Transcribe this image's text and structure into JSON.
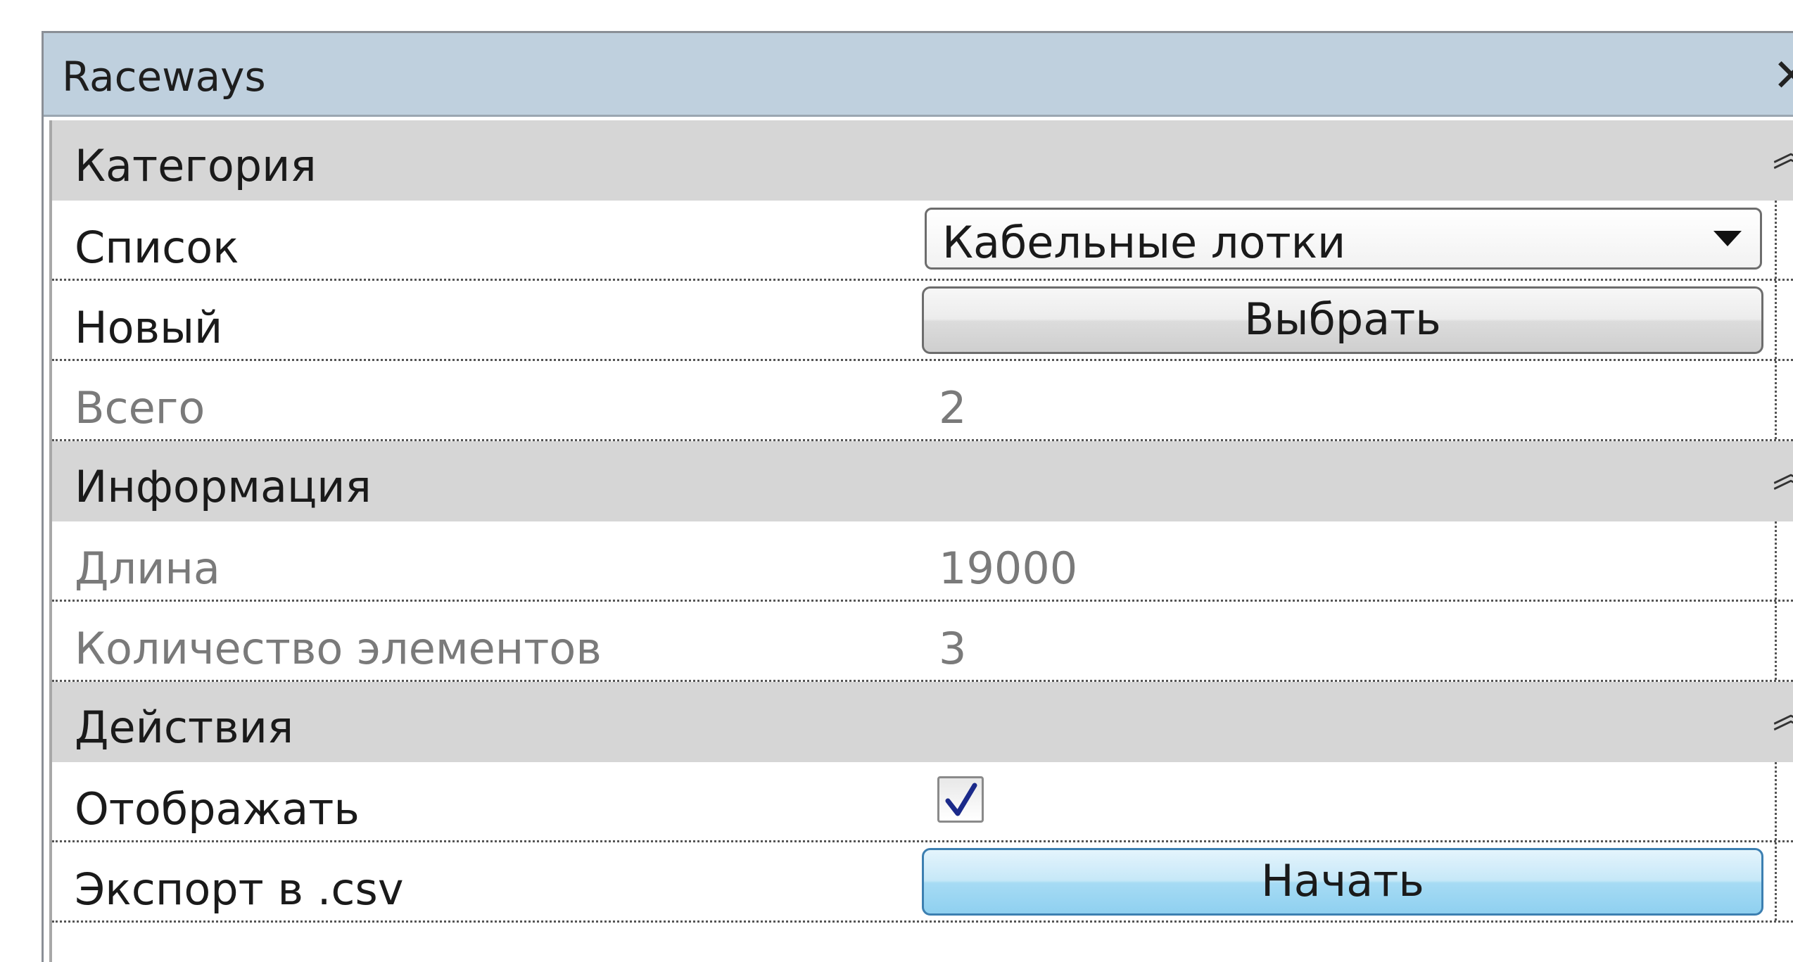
{
  "window": {
    "title": "Raceways",
    "close_glyph": "✕"
  },
  "sections": {
    "category": {
      "label": "Категория",
      "collapse_glyph": "︽"
    },
    "info": {
      "label": "Информация",
      "collapse_glyph": "︽"
    },
    "actions": {
      "label": "Действия",
      "collapse_glyph": "︽"
    }
  },
  "rows": {
    "list": {
      "label": "Список",
      "selected": "Кабельные лотки"
    },
    "new": {
      "label": "Новый",
      "button": "Выбрать"
    },
    "total": {
      "label": "Всего",
      "value": "2"
    },
    "length": {
      "label": "Длина",
      "value": "19000"
    },
    "count": {
      "label": "Количество элементов",
      "value": "3"
    },
    "display": {
      "label": "Отображать",
      "checked": true
    },
    "export": {
      "label": "Экспорт в .csv",
      "button": "Начать"
    }
  },
  "colors": {
    "titlebar": "#bfd0de",
    "section_header": "#d6d6d6",
    "disabled_text": "#7a7a7a",
    "blue_button": "#a6dbf4"
  }
}
